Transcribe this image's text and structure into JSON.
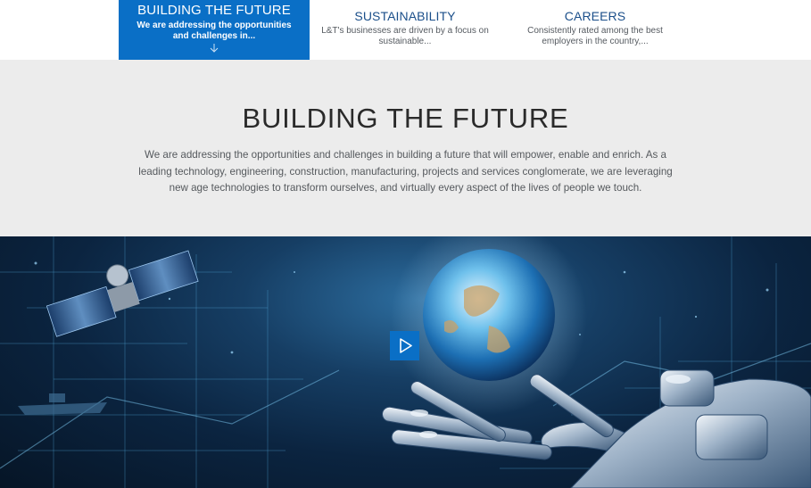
{
  "tabs": [
    {
      "title": "BUILDING THE FUTURE",
      "description": "We are addressing the opportunities and challenges in...",
      "active": true
    },
    {
      "title": "SUSTAINABILITY",
      "description": "L&T's businesses are driven by a focus on sustainable...",
      "active": false
    },
    {
      "title": "CAREERS",
      "description": "Consistently rated among the best employers in the country,...",
      "active": false
    }
  ],
  "intro": {
    "heading": "BUILDING THE FUTURE",
    "body": "We are addressing the opportunities and challenges in building a future that will empower, enable and enrich. As a leading technology, engineering, construction, manufacturing, projects and services conglomerate, we are leveraging new age technologies to transform ourselves, and virtually every aspect of the lives of people we touch."
  },
  "hero": {
    "image_subject": "robotic hand holding glowing globe with satellite and digital grid",
    "play_icon": "play-icon"
  },
  "colors": {
    "accent": "#0a6fc6",
    "tab_text": "#1b4f8a",
    "intro_bg": "#ececec"
  }
}
